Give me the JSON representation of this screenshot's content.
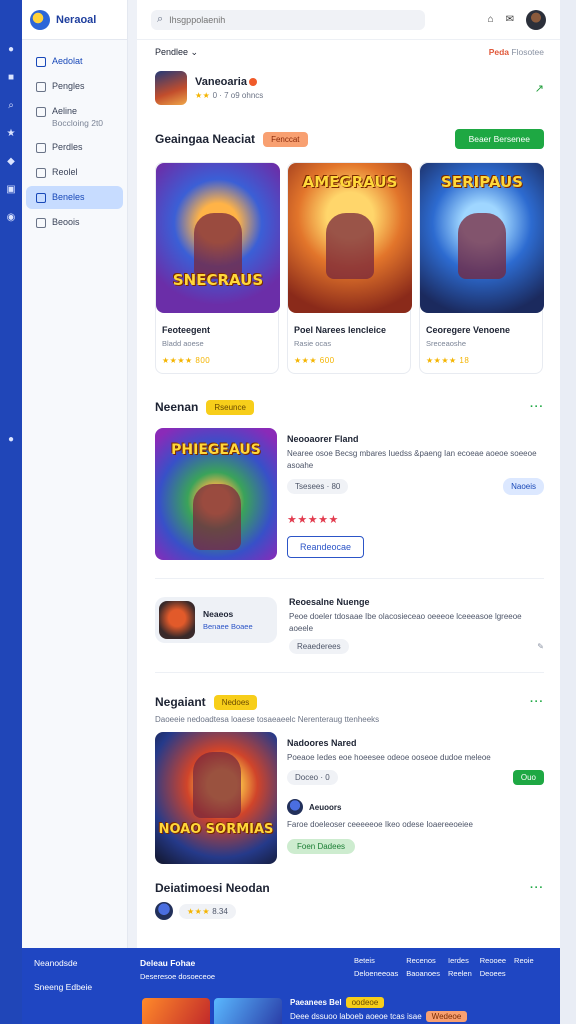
{
  "brand": {
    "name": "Neraoal"
  },
  "search": {
    "placeholder": "Ihsgppolaenih"
  },
  "sidebar": {
    "items": [
      {
        "label": "Aedolat",
        "sub": ""
      },
      {
        "label": "Pengles",
        "sub": ""
      },
      {
        "label": "Aeline",
        "sub": "Boccloing 2t0"
      },
      {
        "label": "Perdles",
        "sub": ""
      },
      {
        "label": "Reolel",
        "sub": ""
      },
      {
        "label": "Beneles",
        "sub": ""
      },
      {
        "label": "Beoois",
        "sub": ""
      }
    ]
  },
  "filter": {
    "left": "Pendlee",
    "right_a": "Peda",
    "right_b": "Flosotee"
  },
  "profile": {
    "name": "Vaneoaria",
    "meta": "0 · 7 o9 ohncs"
  },
  "section1": {
    "title": "Geaingaa Neaciat",
    "tag": "Fenccat",
    "button": "Beaer Bersenee",
    "cards": [
      {
        "art_title": "SNECRAUS",
        "name": "Feoteegent",
        "sub": "Bladd aoese",
        "rating": "★★★★ 800"
      },
      {
        "art_title": "AMEGRAUS",
        "name": "Poel Narees Iencleice",
        "sub": "Rasie ocas",
        "rating": "★★★ 600"
      },
      {
        "art_title": "SERIPAUS",
        "name": "Ceoregere Venoene",
        "sub": "Sreceaoshe",
        "rating": "★★★★ 18"
      }
    ]
  },
  "section2": {
    "title": "Neenan",
    "tag": "Rseunce",
    "feature": {
      "art_title": "PHIEGEAUS",
      "title": "Neooaorer Fland",
      "desc": "Nearee osoe Becsg mbares Iuedss &paeng Ian ecoeae aoeoe soeeoe asoahe",
      "price": "Tsesees · 80",
      "chip": "Naoeis",
      "rating": "★★★★★",
      "button": "Reandeocae"
    },
    "mini": {
      "title": "Neaeos",
      "sub": "Benaee Boaee",
      "side_title": "Reoesalne Nuenge",
      "side_desc": "Peoe doeler tdosaae Ibe olacosieceao oeeeoe lceeeasoe lgreeoe aoeele",
      "side_btn": "Reaederees"
    }
  },
  "section3": {
    "title": "Negaiant",
    "tag": "Nedoes",
    "sub": "Daoeeie nedoadtesa loaese tosaeaeelc Nerenteraug ttenheeks",
    "feature": {
      "art_title": "NOAO SORMIAS",
      "title": "Nadoores Nared",
      "desc": "Poeaoe Iedes eoe hoeesee odeoe ooseoe dudoe meleoe",
      "pill": "Doceo · 0",
      "badge": "Ouo",
      "author": "Aeuoors",
      "author_desc": "Faroe doeleoser ceeeeeoe Ikeo odese Ioaereeoeiee",
      "green_pill": "Foen Dadees"
    }
  },
  "section4": {
    "title": "Deiatimoesi Neodan",
    "rating": "★★★",
    "count": "8.34"
  },
  "footer": {
    "col1_a": "Neanodsde",
    "col1_b": "Sneeng Edbeie",
    "col2_title": "Deleau Fohae",
    "col2_sub": "Deseresoe dosoeceoe",
    "links": [
      "Beteis",
      "Recenos",
      "Ierdes",
      "Reooee",
      "Reoie",
      "Deloeneeoas",
      "Baoanoes",
      "Reelen",
      "Deoees",
      ""
    ],
    "bottom_title": "Paeanees Bel",
    "bottom_tag": "oodeoe",
    "bottom_desc": "Deee dssuoo laboeb aoeoe tcas isae",
    "bottom_tag2": "Wedeoe"
  }
}
